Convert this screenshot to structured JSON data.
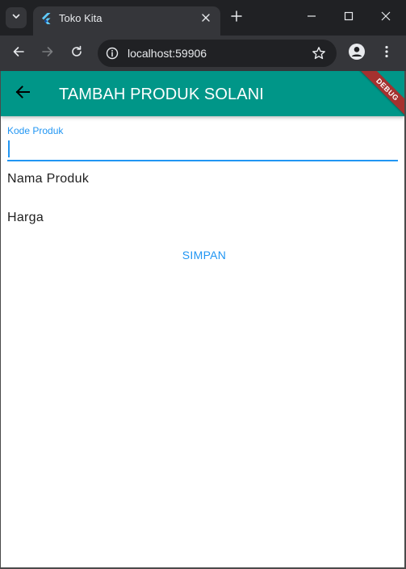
{
  "browser": {
    "tab": {
      "title": "Toko Kita",
      "favicon": "flutter-icon"
    },
    "address_bar": {
      "url": "localhost:59906"
    },
    "icons": {
      "tab_search": "chevron-down-icon",
      "tab_close": "close-icon",
      "new_tab": "plus-icon",
      "minimize": "minimize-icon",
      "maximize": "maximize-icon",
      "close_window": "close-icon",
      "back": "arrow-left-icon",
      "forward": "arrow-right-icon",
      "reload": "reload-icon",
      "site_info": "info-icon",
      "bookmark": "star-icon",
      "profile": "profile-icon",
      "menu": "more-vert-icon"
    }
  },
  "app": {
    "appbar": {
      "title": "TAMBAH PRODUK SOLANI",
      "back_icon": "arrow-back-icon"
    },
    "debug_banner": "DEBUG",
    "form": {
      "kode_produk": {
        "label": "Kode Produk",
        "value": ""
      },
      "nama_produk": {
        "label": "Nama Produk",
        "value": ""
      },
      "harga": {
        "label": "Harga",
        "value": ""
      },
      "submit_label": "SIMPAN"
    }
  },
  "colors": {
    "appbar": "#009688",
    "accent": "#2196f3",
    "debug_banner": "#a6312f",
    "browser_frame": "#202124",
    "browser_toolbar": "#35363a"
  }
}
